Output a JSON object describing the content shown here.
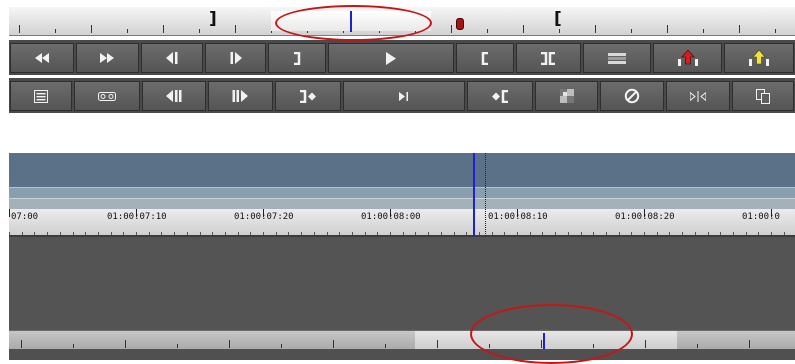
{
  "top_panel": {
    "position_bar": {
      "mark_out_glyph": "]",
      "mark_in_glyph": "["
    },
    "row1_buttons": [
      {
        "name": "rewind-button",
        "icon": "double-left-arrow"
      },
      {
        "name": "fast-forward-button",
        "icon": "double-right-arrow"
      },
      {
        "name": "step-back-one-frame-button",
        "icon": "step-back"
      },
      {
        "name": "step-forward-one-frame-button",
        "icon": "step-forward"
      },
      {
        "name": "mark-out-button",
        "icon": "mark-out-bracket"
      },
      {
        "name": "play-button",
        "icon": "play-triangle"
      },
      {
        "name": "mark-in-button",
        "icon": "mark-in-bracket"
      },
      {
        "name": "mark-clip-button",
        "icon": "mark-clip"
      },
      {
        "name": "clear-marks-button",
        "icon": "clear-marks"
      },
      {
        "name": "lift-button",
        "icon": "lift-red-up-arrow"
      },
      {
        "name": "extract-button",
        "icon": "extract-yellow-up-arrow"
      }
    ],
    "row2_buttons": [
      {
        "name": "match-frame-button",
        "icon": "list"
      },
      {
        "name": "source-tape-button",
        "icon": "tape"
      },
      {
        "name": "step-back-ten-frames-button",
        "icon": "step-back-double"
      },
      {
        "name": "step-forward-ten-frames-button",
        "icon": "step-forward-double"
      },
      {
        "name": "go-to-out-button",
        "icon": "go-to-out"
      },
      {
        "name": "play-to-out-button",
        "icon": "play-to-out"
      },
      {
        "name": "go-to-in-button",
        "icon": "go-to-in"
      },
      {
        "name": "video-quality-button",
        "icon": "checkerboard"
      },
      {
        "name": "clear-button",
        "icon": "circle-slash"
      },
      {
        "name": "trim-mode-button",
        "icon": "trim-arrows"
      },
      {
        "name": "copy-button",
        "icon": "copy-pages"
      }
    ]
  },
  "timeline": {
    "timecodes": [
      "07:00",
      "01:00:07:10",
      "01:00:07:20",
      "01:00:08:00",
      "01:00:08:10",
      "01:00:08:20",
      "01:00:0"
    ]
  },
  "colors": {
    "annotation_red": "#c81414",
    "playhead_blue": "#1f1fd6",
    "track_blue": "#5a7187",
    "button_gray": "#5f5f5f"
  }
}
